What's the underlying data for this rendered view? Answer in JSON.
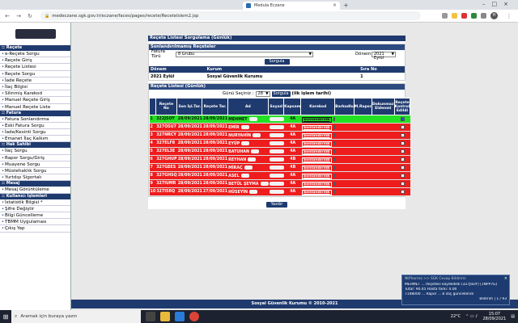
{
  "browser": {
    "tab_title": "Medula Eczane",
    "url": "medeczane.sgk.gov.tr/eczane/faces/pages/recete/ReceteIslem2.jsp"
  },
  "sidebar": {
    "groups": [
      {
        "title": ":: Reçete",
        "items": [
          "e-Reçete Sorgu",
          "Reçete Giriş",
          "Reçete Listesi",
          "Reçete Sorgu",
          "İade Reçete",
          "İlaç Bilgisi",
          "Silinmiş Karekod",
          "Manuel Reçete Giriş",
          "Manuel Reçete Liste"
        ]
      },
      {
        "title": ":: Fatura",
        "items": [
          "Fatura Sonlandırma",
          "Eski Fatura Sorgu",
          "İade/Kesinti Sorgu",
          "Emanet İlaç Kalkım"
        ]
      },
      {
        "title": ":: Hak Sahibi",
        "items": [
          "İlaç Sorgu",
          "Rapor Sorgu/Giriş",
          "Muayene Sorgu",
          "Müstehaklık Sorgu",
          "Yurtdışı Sigortalı"
        ]
      },
      {
        "title": ":: Mesaj",
        "items": [
          "Mesaj Görüntüleme"
        ]
      },
      {
        "title": ":: Kullanıcı İşlemleri",
        "items": [
          "İstatistik Bilgisi *",
          "Şifre Değiştir",
          "Bilgi Güncelleme",
          "TBMM Uygulaması",
          "Çıkış Yap"
        ]
      }
    ]
  },
  "page": {
    "title": "Reçete Listesi Sorgulama (Günlük)",
    "unfinished_box": {
      "title": "Sonlandırılmamış Reçeteler",
      "fatura_label": "Fatura Türü",
      "fatura_value": "8 Grubu",
      "donem_label": "Dönem",
      "donem_value": "2021 Eylül",
      "sorgula": "Sorgula",
      "table_headers": [
        "Dönem",
        "Kurum",
        "Sıra No"
      ],
      "table_row": [
        "2021 Eylül",
        "Sosyal Güvenlik Kurumu",
        "1"
      ]
    },
    "list_box": {
      "title": "Reçete Listesi (Günlük)",
      "gun_label": "Günü Seçiniz :",
      "gun_value": "28",
      "sorgula": "Sorgula",
      "gun_note": "(ilk işlem tarihi)",
      "headers": [
        "",
        "Reçete No",
        "Son İşl.Tar.",
        "Reçete Tar.",
        "Ad",
        "Soyad",
        "Kapsam",
        "Karekod",
        "Barkodlu",
        "M.Rapor",
        "Dokunmaz Eldenmi",
        "Reçete Kontrol Edildi"
      ],
      "rows": [
        {
          "n": "1",
          "no": "322JSOY",
          "son": "28/09/2021",
          "tar": "28/09/2021",
          "ad": "MEHMET",
          "kapsam": "4A",
          "karekod": "Sonlandırıldı",
          "status": "green",
          "checked": true
        },
        {
          "n": "2",
          "no": "327OSU7",
          "son": "28/09/2021",
          "tar": "28/09/2021",
          "ad": "EMİR",
          "kapsam": "4A",
          "karekod": "Sonlandırıldı",
          "status": "red",
          "checked": false
        },
        {
          "n": "3",
          "no": "327NRCY",
          "son": "28/09/2021",
          "tar": "28/09/2021",
          "ad": "NURYAHİN",
          "kapsam": "4A",
          "karekod": "Sonlandırıldı",
          "status": "red",
          "checked": false
        },
        {
          "n": "4",
          "no": "327ELF8",
          "son": "28/09/2021",
          "tar": "28/09/2021",
          "ad": "EYÜP",
          "kapsam": "4A",
          "karekod": "Sonlandırıldı",
          "status": "red",
          "checked": false
        },
        {
          "n": "5",
          "no": "327EL3E",
          "son": "28/09/2021",
          "tar": "28/09/2021",
          "ad": "BATUHAN",
          "kapsam": "4A",
          "karekod": "Sonlandırıldı",
          "status": "red",
          "checked": false
        },
        {
          "n": "6",
          "no": "327GHUP",
          "son": "28/09/2021",
          "tar": "28/09/2021",
          "ad": "REYHAN",
          "kapsam": "4B",
          "karekod": "Sonlandırıldı",
          "status": "red",
          "checked": false
        },
        {
          "n": "7",
          "no": "327GEES",
          "son": "28/09/2021",
          "tar": "28/09/2021",
          "ad": "MİRAÇ",
          "kapsam": "4B",
          "karekod": "Sonlandırıldı",
          "status": "red",
          "checked": false
        },
        {
          "n": "8",
          "no": "327GHSQ",
          "son": "28/09/2021",
          "tar": "28/09/2021",
          "ad": "ASEL",
          "kapsam": "4A",
          "karekod": "Sonlandırıldı",
          "status": "red",
          "checked": false
        },
        {
          "n": "9",
          "no": "327IUMR",
          "son": "28/09/2021",
          "tar": "28/09/2021",
          "ad": "BETÜL ŞEYMA",
          "kapsam": "4A",
          "karekod": "Sonlandırıldı",
          "status": "red",
          "checked": false
        },
        {
          "n": "10",
          "no": "327ISRQ",
          "son": "28/09/2021",
          "tar": "27/09/2021",
          "ad": "HÜSEYİN",
          "kapsam": "4A",
          "karekod": "Sonlandırıldı",
          "status": "red",
          "checked": false
        }
      ],
      "yazdir": "Yazdır"
    },
    "footer": "Sosyal Güvenlik Kurumu © 2010-2021"
  },
  "notification": {
    "title": "NtPharma >> SGK Cevap Bildirimi",
    "lines": [
      "MEHMET ... Reçetesi kaydedildi (327JSOY) [1NPP7G]",
      "Tutar: 90.45 Hasta farkı: 4.00",
      "7148000 ... Rapor ... 8 ilaç güncellendi",
      "Bildirim | 1 / 93"
    ]
  },
  "taskbar": {
    "search_placeholder": "Aramak için buraya yazın",
    "weather": "22°C",
    "time": "15:07",
    "date": "28/09/2021"
  },
  "colors": {
    "nav_blue": "#1f3a6e",
    "row_red": "#ee1c1c",
    "row_green": "#22e022"
  }
}
